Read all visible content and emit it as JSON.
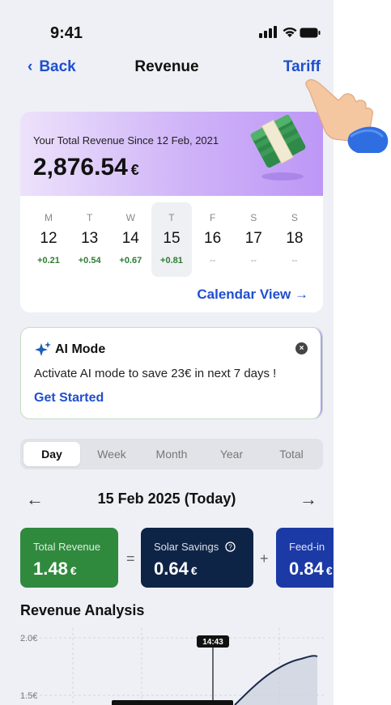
{
  "status": {
    "time": "9:41"
  },
  "nav": {
    "back": "Back",
    "title": "Revenue",
    "tariff": "Tariff"
  },
  "revenue_card": {
    "label": "Your Total Revenue Since 12 Feb, 2021",
    "value": "2,876.54",
    "currency": "€",
    "days": [
      {
        "dow": "M",
        "num": "12",
        "delta": "+0.21"
      },
      {
        "dow": "T",
        "num": "13",
        "delta": "+0.54"
      },
      {
        "dow": "W",
        "num": "14",
        "delta": "+0.67"
      },
      {
        "dow": "T",
        "num": "15",
        "delta": "+0.81"
      },
      {
        "dow": "F",
        "num": "16",
        "delta": "--"
      },
      {
        "dow": "S",
        "num": "17",
        "delta": "--"
      },
      {
        "dow": "S",
        "num": "18",
        "delta": "--"
      }
    ],
    "calendar_link": "Calendar View →"
  },
  "ai_card": {
    "title": "AI Mode",
    "description": "Activate AI mode to save 23€ in next 7 days !",
    "cta": "Get Started"
  },
  "period_tabs": [
    "Day",
    "Week",
    "Month",
    "Year",
    "Total"
  ],
  "date_nav": {
    "prev": "←",
    "label": "15 Feb 2025 (Today)",
    "next": "→"
  },
  "metrics": [
    {
      "label": "Total Revenue",
      "value": "1.48",
      "currency": "€",
      "color": "#2f8a3d"
    },
    {
      "label": "Solar Savings",
      "value": "0.64",
      "currency": "€",
      "color": "#0e2447"
    },
    {
      "label": "Feed-in",
      "value": "0.84",
      "currency": "€",
      "color": "#1c3aa6"
    }
  ],
  "operators": [
    "=",
    "+"
  ],
  "analysis": {
    "title": "Revenue Analysis",
    "y_ticks": [
      "2.0€",
      "1.5€"
    ],
    "marker_time": "14:43"
  },
  "colors": {
    "accent": "#1f4fcf",
    "positive": "#2e7d32"
  }
}
